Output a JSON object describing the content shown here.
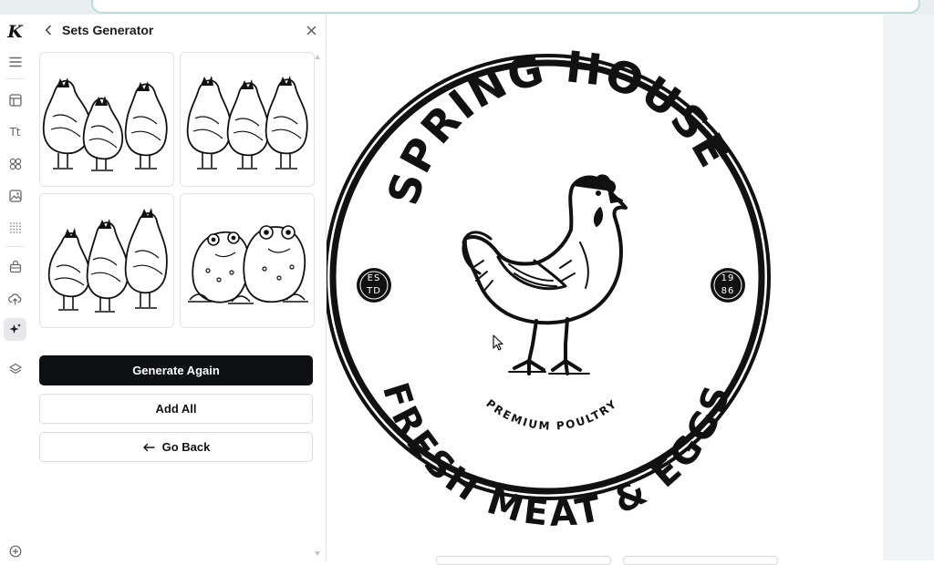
{
  "browser": {
    "tab_hint": ""
  },
  "rail": {
    "logo": "K",
    "items": [
      {
        "icon": "menu-icon"
      },
      {
        "icon": "layout-icon"
      },
      {
        "icon": "text-icon",
        "label": "Tt"
      },
      {
        "icon": "elements-icon"
      },
      {
        "icon": "image-icon"
      },
      {
        "icon": "grid-icon"
      },
      {
        "icon": "brand-kit-icon"
      },
      {
        "icon": "upload-icon"
      },
      {
        "icon": "magic-sparkle-icon",
        "active": true
      },
      {
        "icon": "layers-icon"
      },
      {
        "icon": "add-circle-icon"
      }
    ]
  },
  "panel": {
    "title": "Sets Generator",
    "results": [
      {
        "subject": "three hens"
      },
      {
        "subject": "three hens"
      },
      {
        "subject": "three hens"
      },
      {
        "subject": "two toads"
      }
    ],
    "generate_again_label": "Generate Again",
    "add_all_label": "Add All",
    "go_back_label": "Go Back"
  },
  "logo": {
    "top_text": "SPRING HOUSE",
    "bottom_text": "FRESH MEAT & EGGS",
    "tagline": "PREMIUM POULTRY",
    "left_badge_line1": "ES",
    "left_badge_line2": "TD",
    "right_badge_line1": "19",
    "right_badge_line2": "86",
    "ink_color": "#111111"
  }
}
